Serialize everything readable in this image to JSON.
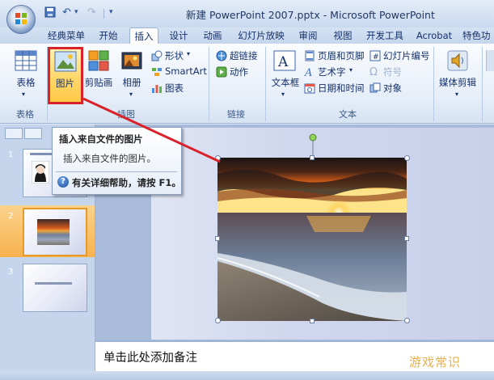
{
  "window": {
    "title": "新建 PowerPoint 2007.pptx - Microsoft PowerPoint"
  },
  "tabs": [
    {
      "label": "经典菜单"
    },
    {
      "label": "开始"
    },
    {
      "label": "插入"
    },
    {
      "label": "设计"
    },
    {
      "label": "动画"
    },
    {
      "label": "幻灯片放映"
    },
    {
      "label": "审阅"
    },
    {
      "label": "视图"
    },
    {
      "label": "开发工具"
    },
    {
      "label": "Acrobat"
    },
    {
      "label": "特色功"
    }
  ],
  "ribbon": {
    "groups": {
      "table": "表格",
      "illustrations": "插图",
      "links": "链接",
      "text": "文本"
    },
    "buttons": {
      "table": "表格",
      "picture": "图片",
      "clipart": "剪贴画",
      "album": "相册",
      "shapes": "形状",
      "smartart": "SmartArt",
      "chart": "图表",
      "hyperlink": "超链接",
      "action": "动作",
      "textbox": "文本框",
      "header_footer": "页眉和页脚",
      "wordart": "艺术字",
      "datetime": "日期和时间",
      "slide_number": "幻灯片编号",
      "symbol": "符号",
      "object": "对象",
      "media_clips": "媒体剪辑"
    }
  },
  "tooltip": {
    "title": "插入来自文件的图片",
    "description": "插入来自文件的图片。",
    "help": "有关详细帮助，请按 F1。"
  },
  "slides": [
    {
      "number": "1"
    },
    {
      "number": "2"
    },
    {
      "number": "3"
    }
  ],
  "notes": {
    "placeholder": "单击此处添加备注"
  },
  "watermark": "游戏常识",
  "colors": {
    "highlight_red": "#d9222a",
    "selected_button": "#ffd86a",
    "selected_slide": "#f7b24e"
  }
}
